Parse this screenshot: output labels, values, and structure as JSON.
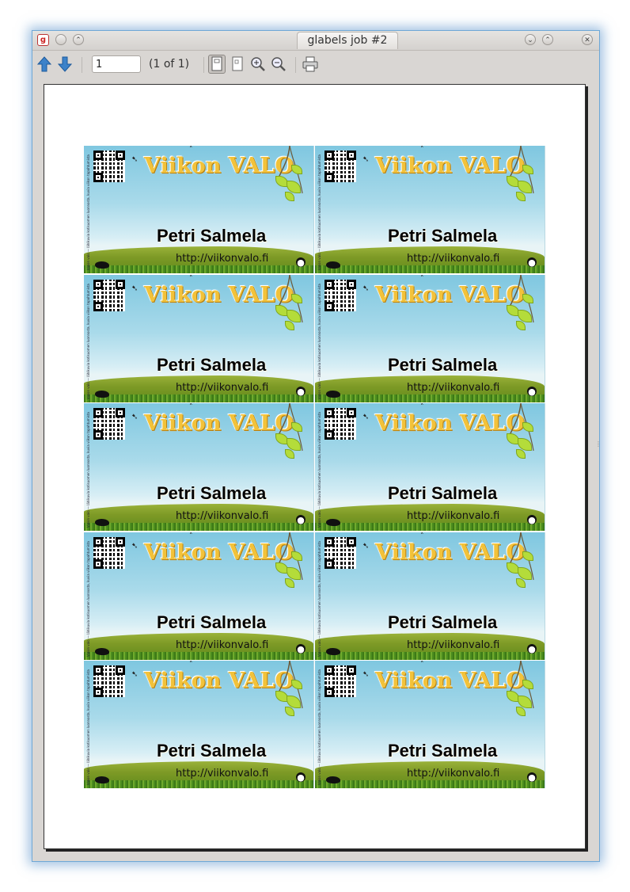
{
  "window": {
    "title": "glabels job #2",
    "app_icon": "glabels-icon"
  },
  "toolbar": {
    "page_value": "1",
    "page_of": "(1 of 1)"
  },
  "card": {
    "logo": "Viikon VALO",
    "name": "Petri Salmela",
    "url": "http://viikonvalo.fi",
    "side_text": "Viikon valo — lähikuvia kotisuomen luonnosta, kuvia viikon tapahtumista"
  },
  "sheet": {
    "rows": 5,
    "columns": 2
  },
  "colors": {
    "sky_top": "#7fc7e0",
    "grass": "#7e9a26",
    "logo": "#f2c23a",
    "window_glow": "#6fa8d6"
  }
}
